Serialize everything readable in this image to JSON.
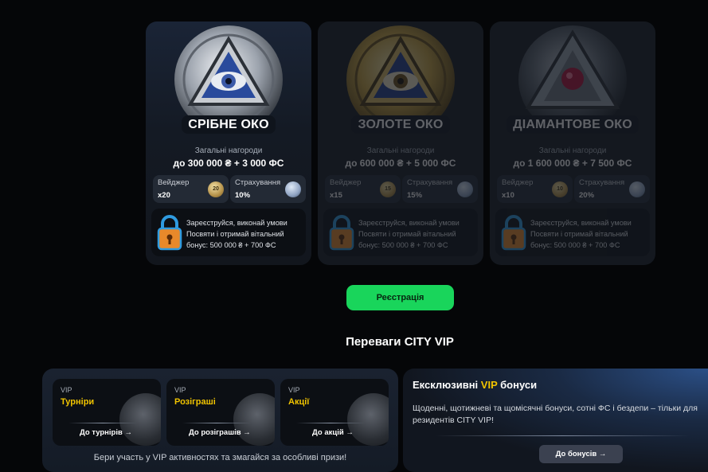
{
  "cards": [
    {
      "title": "СРІБНЕ ОКО",
      "subtitle": "Загальні нагороди",
      "amount": "до 300 000 ₴ + 3 000 ФС",
      "wager_label": "Вейджер",
      "wager_value": "x20",
      "wager_badge": "20",
      "insurance_label": "Страхування",
      "insurance_value": "10%",
      "lock_text": "Зареєструйся, виконай умови Посвяти і отримай вітальний бонус: 500 000 ₴ + 700 ФС",
      "state": "active"
    },
    {
      "title": "ЗОЛОТЕ ОКО",
      "subtitle": "Загальні нагороди",
      "amount": "до 600 000 ₴ + 5 000 ФС",
      "wager_label": "Вейджер",
      "wager_value": "x15",
      "wager_badge": "15",
      "insurance_label": "Страхування",
      "insurance_value": "15%",
      "lock_text": "Зареєструйся, виконай умови Посвяти і отримай вітальний бонус: 500 000 ₴ + 700 ФС",
      "state": "dimmed"
    },
    {
      "title": "ДІАМАНТОВЕ ОКО",
      "subtitle": "Загальні нагороди",
      "amount": "до 1 600 000 ₴ + 7 500 ФС",
      "wager_label": "Вейджер",
      "wager_value": "x10",
      "wager_badge": "10",
      "insurance_label": "Страхування",
      "insurance_value": "20%",
      "lock_text": "Зареєструйся, виконай умови Посвяти і отримай вітальний бонус: 500 000 ₴ + 700 ФС",
      "state": "dimmed"
    }
  ],
  "register_button": "Реєстрація",
  "section_title": "Переваги CITY VIP",
  "vip_items": [
    {
      "tag": "VIP",
      "name": "Турніри",
      "link": "До турнірів"
    },
    {
      "tag": "VIP",
      "name": "Розіграші",
      "link": "До розіграшів"
    },
    {
      "tag": "VIP",
      "name": "Акції",
      "link": "До акцій"
    }
  ],
  "vip_footer": "Бери участь у VIP активностях та змагайся за особливі призи!",
  "bonus": {
    "title_prefix": "Ексклюзивні ",
    "title_vip": "VIP",
    "title_suffix": " бонуси",
    "text": "Щоденні, щотижневі та щомісячні бонуси, сотні ФС і бездепи – тільки для резидентів CITY VIP!",
    "button": "До бонусів"
  },
  "colors": {
    "accent_green": "#19d55b",
    "vip_yellow": "#f1c400",
    "background": "#050608"
  },
  "icons": [
    "eye-coin-icon",
    "padlock-icon",
    "gold-coin-badge-icon",
    "shield-badge-icon",
    "arrow-right-icon",
    "sword-emblem-icon",
    "dice-emblem-icon",
    "vip-emblem-icon"
  ]
}
